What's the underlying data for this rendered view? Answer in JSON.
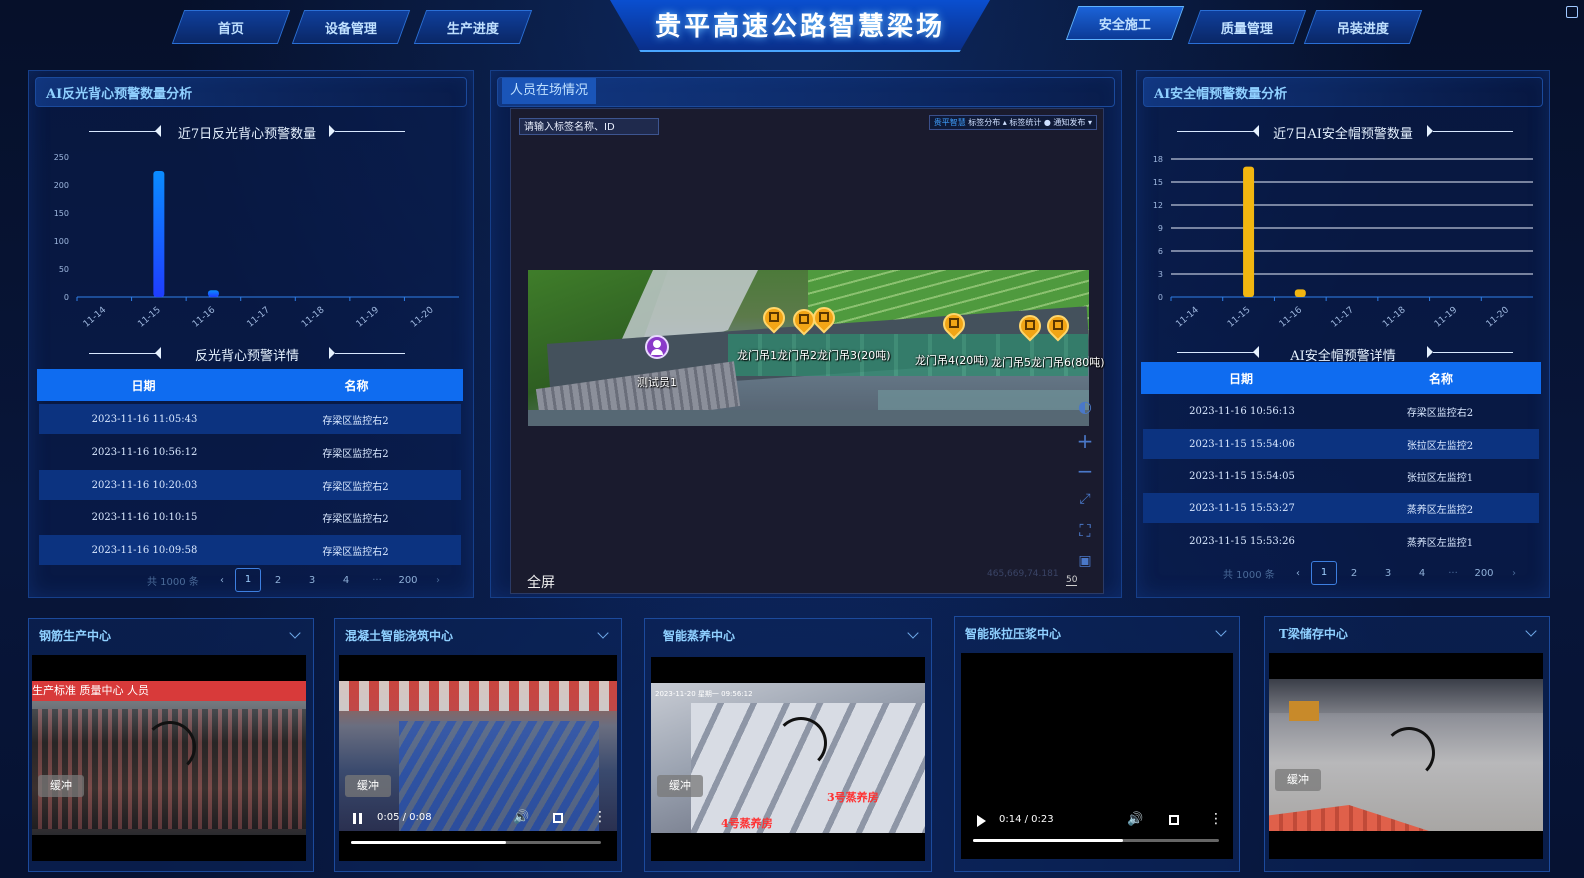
{
  "header": {
    "title": "贵平高速公路智慧梁场",
    "nav_left": [
      "首页",
      "设备管理",
      "生产进度"
    ],
    "nav_right": [
      "安全施工",
      "质量管理",
      "吊装进度"
    ],
    "active_nav": "安全施工"
  },
  "vest_panel": {
    "title": "AI反光背心预警数量分析",
    "chart_title": "近7日反光背心预警数量",
    "detail_title": "反光背心预警详情",
    "columns": [
      "日期",
      "名称"
    ],
    "rows": [
      {
        "date": "2023-11-16 11:05:43",
        "name": "存梁区监控右2"
      },
      {
        "date": "2023-11-16 10:56:12",
        "name": "存梁区监控右2"
      },
      {
        "date": "2023-11-16 10:20:03",
        "name": "存梁区监控右2"
      },
      {
        "date": "2023-11-16 10:10:15",
        "name": "存梁区监控右2"
      },
      {
        "date": "2023-11-16 10:09:58",
        "name": "存梁区监控右2"
      }
    ],
    "pager": {
      "total": "共 1000 条",
      "pages": [
        "1",
        "2",
        "3",
        "4",
        "···",
        "200"
      ],
      "current": "1"
    }
  },
  "helmet_panel": {
    "title": "AI安全帽预警数量分析",
    "chart_title": "近7日AI安全帽预警数量",
    "detail_title": "AI安全帽预警详情",
    "columns": [
      "日期",
      "名称"
    ],
    "rows": [
      {
        "date": "2023-11-16 10:56:13",
        "name": "存梁区监控右2"
      },
      {
        "date": "2023-11-15 15:54:06",
        "name": "张拉区左监控2"
      },
      {
        "date": "2023-11-15 15:54:05",
        "name": "张拉区左监控1"
      },
      {
        "date": "2023-11-15 15:53:27",
        "name": "蒸养区左监控2"
      },
      {
        "date": "2023-11-15 15:53:26",
        "name": "蒸养区左监控1"
      }
    ],
    "pager": {
      "total": "共 1000 条",
      "pages": [
        "1",
        "2",
        "3",
        "4",
        "···",
        "200"
      ],
      "current": "1"
    }
  },
  "chart_data": [
    {
      "type": "bar",
      "title": "近7日反光背心预警数量",
      "categories": [
        "11-14",
        "11-15",
        "11-16",
        "11-17",
        "11-18",
        "11-19",
        "11-20"
      ],
      "values": [
        0,
        225,
        12,
        0,
        0,
        0,
        0
      ],
      "yticks": [
        "0",
        "50",
        "100",
        "150",
        "200",
        "250"
      ],
      "ylim": [
        0,
        250
      ],
      "grid": false,
      "colors": [
        "#0a8cff",
        "#1f3dff"
      ]
    },
    {
      "type": "bar",
      "title": "近7日AI安全帽预警数量",
      "categories": [
        "11-14",
        "11-15",
        "11-16",
        "11-17",
        "11-18",
        "11-19",
        "11-20"
      ],
      "values": [
        0,
        17,
        1,
        0,
        0,
        0,
        0
      ],
      "yticks": [
        "0",
        "3",
        "6",
        "9",
        "12",
        "15",
        "18"
      ],
      "ylim": [
        0,
        18
      ],
      "grid": true,
      "colors": [
        "#f2b610"
      ]
    }
  ],
  "personnel_panel": {
    "tab": "人员在场情况",
    "search_placeholder": "请输入标签名称、ID",
    "toolbar": {
      "brand": "贵平智慧",
      "items": "标签分布 ▴  标签统计 ●  通知发布 ▾"
    },
    "labels": {
      "person": "测试员1",
      "crane_group_a": "龙门吊1龙门吊2龙门吊3(20吨)",
      "crane_b": "龙门吊4(20吨)",
      "crane_group_c": "龙门吊5龙门吊6(80吨)"
    },
    "fullscreen": "全屏",
    "coords": "465,669,74.181",
    "scale": "50"
  },
  "videos": [
    {
      "title": "钢筋生产中心",
      "buffer": "缓冲"
    },
    {
      "title": "混凝土智能浇筑中心",
      "buffer": "缓冲",
      "time": "0:05 / 0:08",
      "progress": 0.62
    },
    {
      "title": "智能蒸养中心",
      "buffer": "缓冲",
      "overlay": "2023-11-20 星期一 09:56:12",
      "sign1": "4号蒸养房",
      "sign2": "3号蒸养房"
    },
    {
      "title": "智能张拉压浆中心",
      "time": "0:14 / 0:23",
      "progress": 0.61
    },
    {
      "title": "T梁储存中心",
      "buffer": "缓冲"
    }
  ],
  "video_banner": "生产标准  质量中心  人员"
}
